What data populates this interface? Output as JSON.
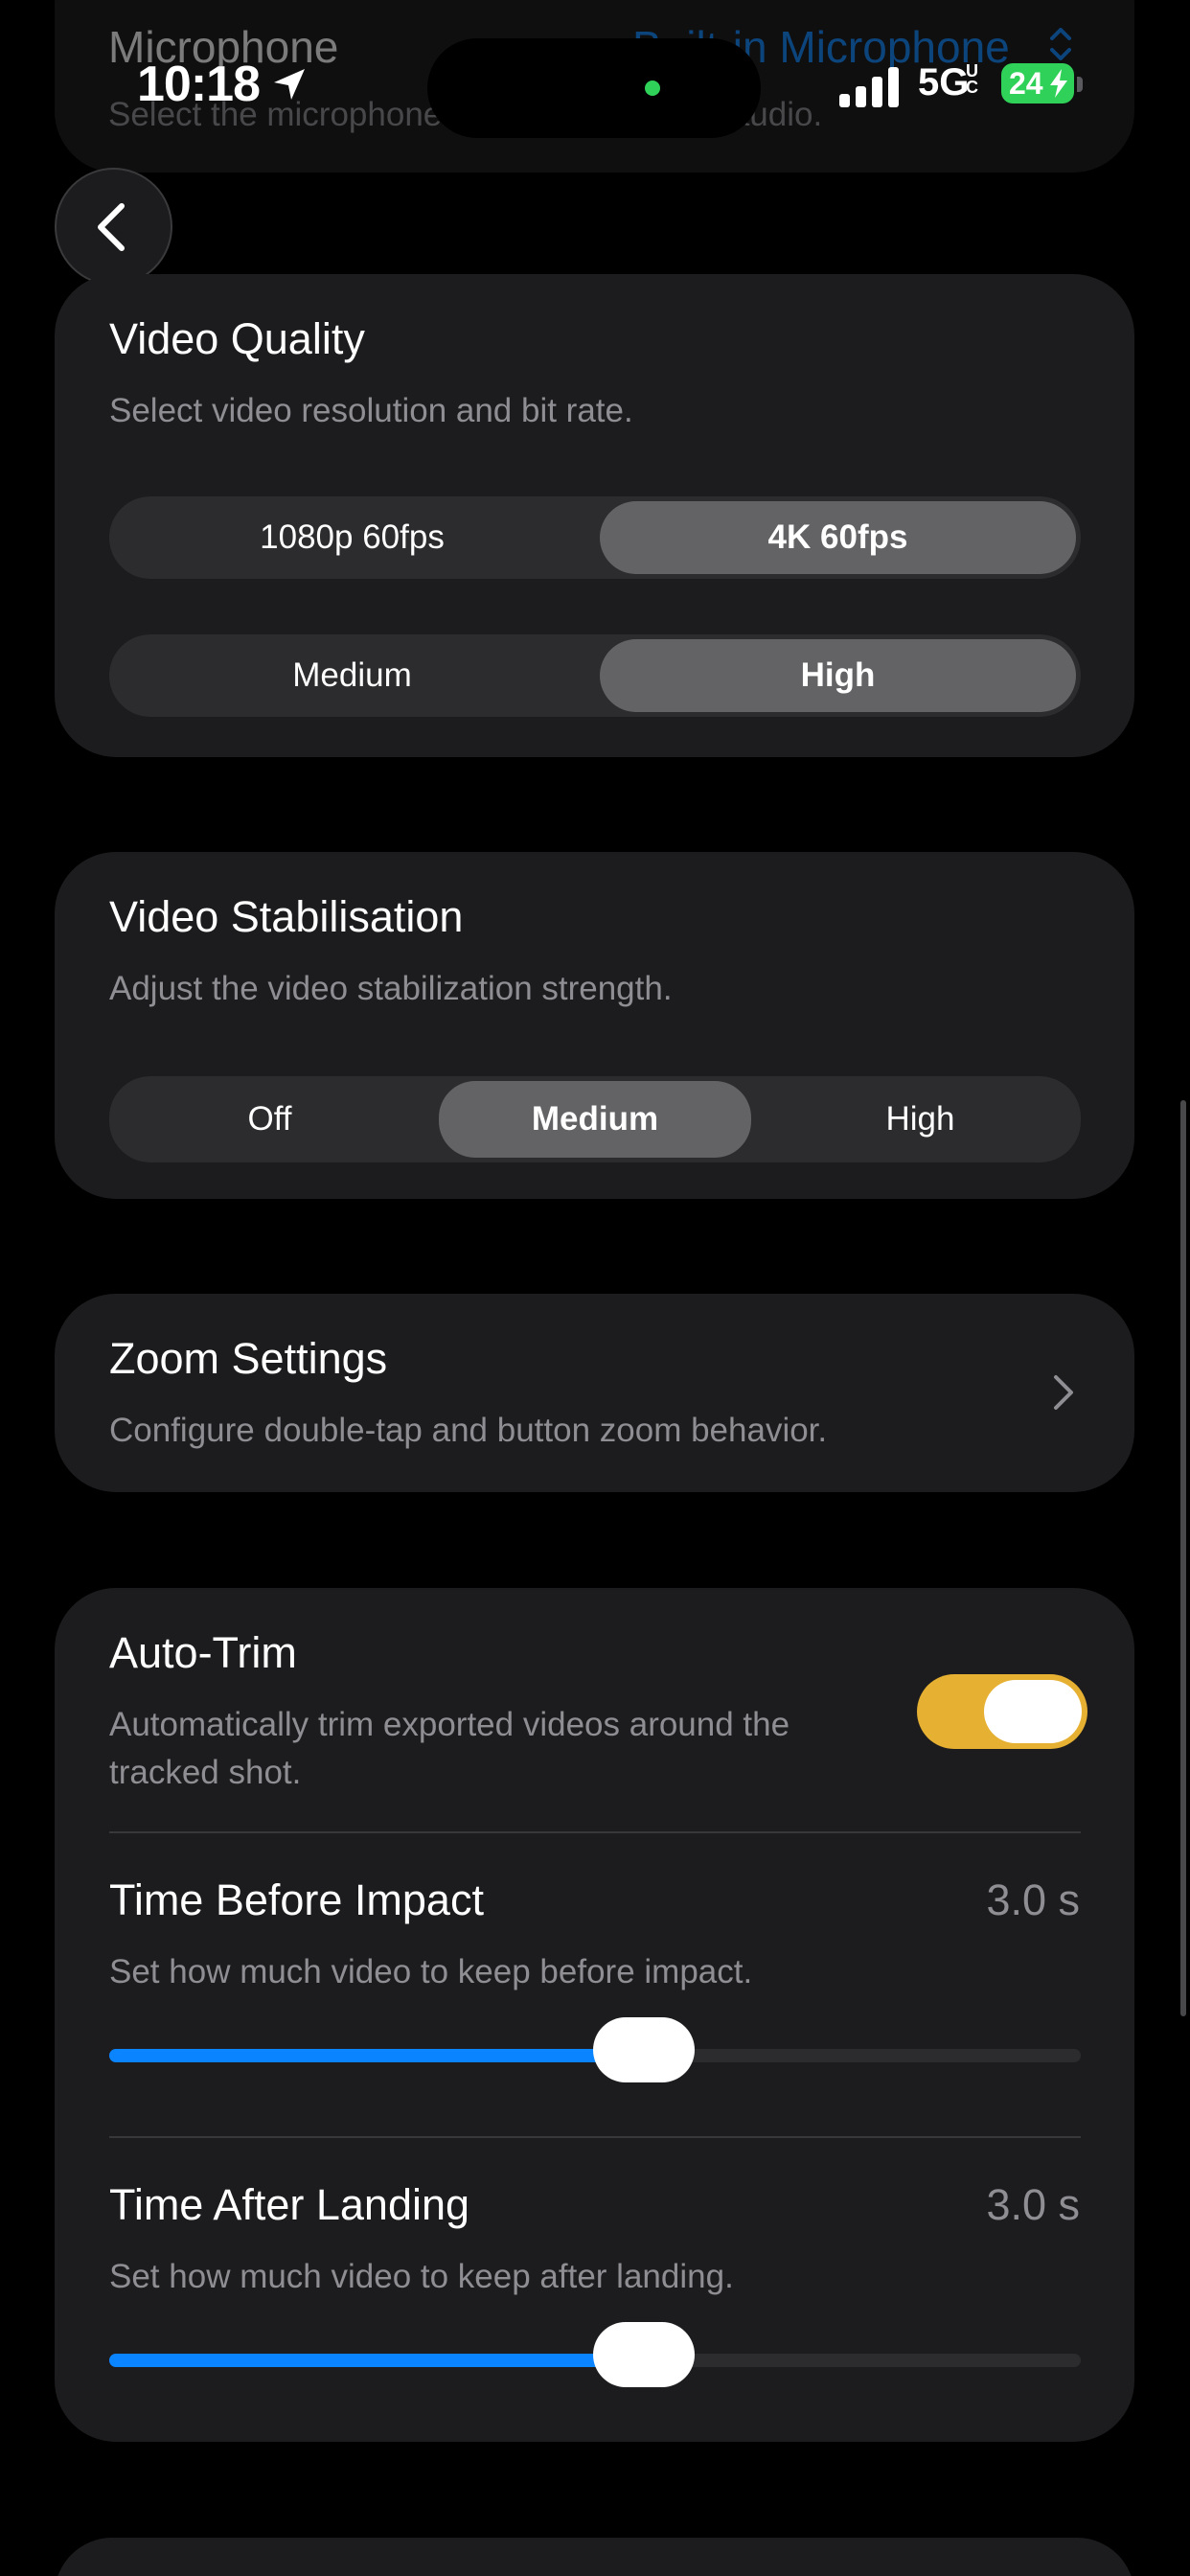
{
  "status_bar": {
    "time": "10:18",
    "network": "5G",
    "network_sup": "UC",
    "battery": "24"
  },
  "microphone": {
    "title": "Microphone",
    "value": "Built-in Microphone",
    "subtitle": "Select the microphone used for recording audio."
  },
  "video_quality": {
    "title": "Video Quality",
    "subtitle": "Select video resolution and bit rate.",
    "resolution_options": [
      "1080p 60fps",
      "4K 60fps"
    ],
    "resolution_selected": "4K 60fps",
    "bitrate_options": [
      "Medium",
      "High"
    ],
    "bitrate_selected": "High"
  },
  "stabilisation": {
    "title": "Video Stabilisation",
    "subtitle": "Adjust the video stabilization strength.",
    "options": [
      "Off",
      "Medium",
      "High"
    ],
    "selected": "Medium"
  },
  "zoom": {
    "title": "Zoom Settings",
    "subtitle": "Configure double-tap and button zoom behavior."
  },
  "auto_trim": {
    "title": "Auto-Trim",
    "subtitle_line1": "Automatically trim exported videos around the",
    "subtitle_line2": "tracked shot.",
    "enabled": true,
    "time_before": {
      "title": "Time Before Impact",
      "value": "3.0 s",
      "subtitle": "Set how much video to keep before impact.",
      "fraction": 0.55
    },
    "time_after": {
      "title": "Time After Landing",
      "value": "3.0 s",
      "subtitle": "Set how much video to keep after landing.",
      "fraction": 0.55
    }
  },
  "colors": {
    "accent": "#0a84ff",
    "toggle_on": "#e6b032",
    "card": "#1c1c1e",
    "battery": "#30d158"
  }
}
